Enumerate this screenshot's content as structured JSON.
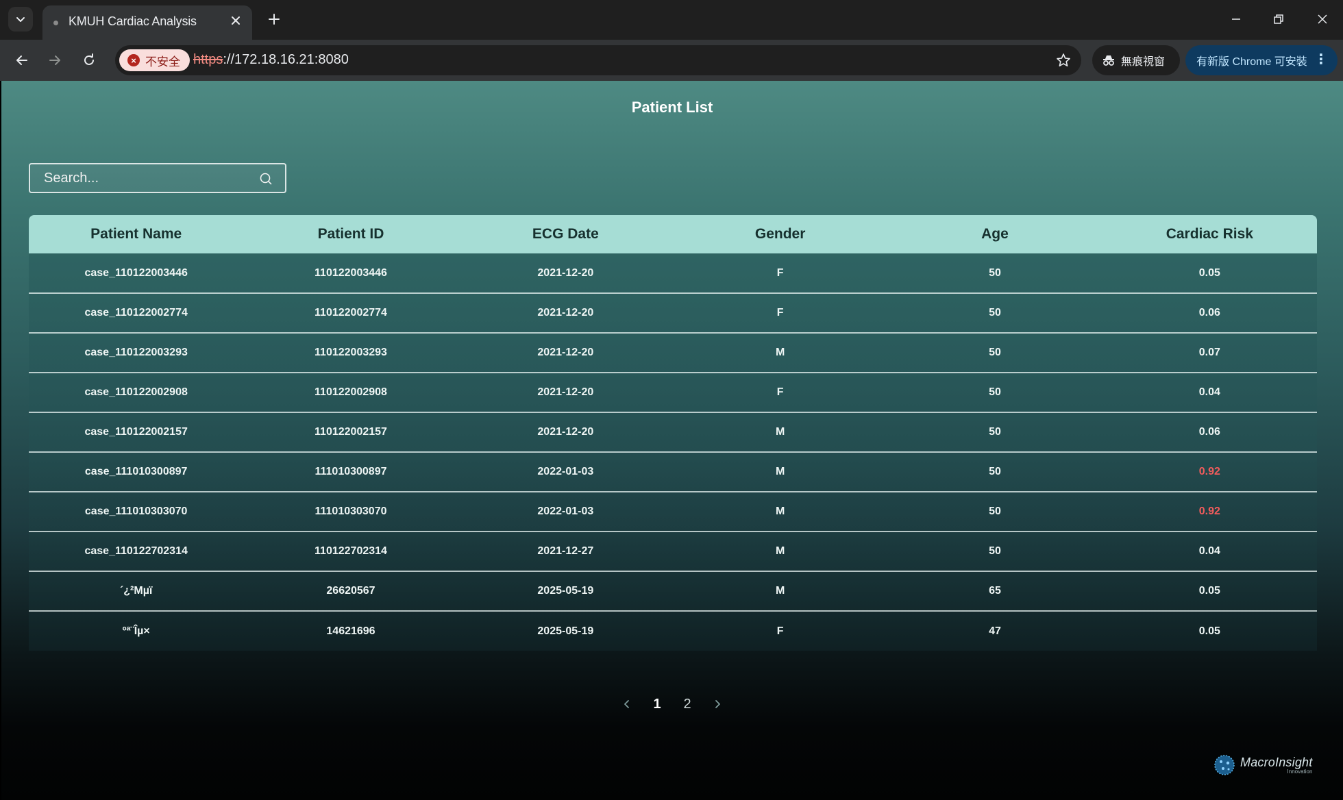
{
  "browser": {
    "tab_title": "KMUH Cardiac Analysis",
    "security_label": "不安全",
    "url_scheme": "https",
    "url_rest": "://172.18.16.21:8080",
    "incognito_label": "無痕視窗",
    "update_label": "有新版 Chrome 可安裝"
  },
  "page": {
    "title": "Patient List",
    "search": {
      "placeholder": "Search..."
    }
  },
  "table": {
    "headers": [
      "Patient Name",
      "Patient ID",
      "ECG Date",
      "Gender",
      "Age",
      "Cardiac Risk"
    ],
    "rows": [
      {
        "name": "case_110122003446",
        "id": "110122003446",
        "date": "2021-12-20",
        "gender": "F",
        "age": "50",
        "risk": "0.05"
      },
      {
        "name": "case_110122002774",
        "id": "110122002774",
        "date": "2021-12-20",
        "gender": "F",
        "age": "50",
        "risk": "0.06"
      },
      {
        "name": "case_110122003293",
        "id": "110122003293",
        "date": "2021-12-20",
        "gender": "M",
        "age": "50",
        "risk": "0.07"
      },
      {
        "name": "case_110122002908",
        "id": "110122002908",
        "date": "2021-12-20",
        "gender": "F",
        "age": "50",
        "risk": "0.04"
      },
      {
        "name": "case_110122002157",
        "id": "110122002157",
        "date": "2021-12-20",
        "gender": "M",
        "age": "50",
        "risk": "0.06"
      },
      {
        "name": "case_111010300897",
        "id": "111010300897",
        "date": "2022-01-03",
        "gender": "M",
        "age": "50",
        "risk": "0.92"
      },
      {
        "name": "case_111010303070",
        "id": "111010303070",
        "date": "2022-01-03",
        "gender": "M",
        "age": "50",
        "risk": "0.92"
      },
      {
        "name": "case_110122702314",
        "id": "110122702314",
        "date": "2021-12-27",
        "gender": "M",
        "age": "50",
        "risk": "0.04"
      },
      {
        "name": "´¿²Mµï",
        "id": "26620567",
        "date": "2025-05-19",
        "gender": "M",
        "age": "65",
        "risk": "0.05"
      },
      {
        "name": "ºª¨Îµ×",
        "id": "14621696",
        "date": "2025-05-19",
        "gender": "F",
        "age": "47",
        "risk": "0.05"
      }
    ]
  },
  "pagination": {
    "pages": [
      "1",
      "2"
    ],
    "current": "1"
  },
  "logo": {
    "name": "MacroInsight",
    "tagline": "Innovation"
  },
  "colors": {
    "header_bg": "#a6ddd5",
    "high_risk": "#f25c5c",
    "insecure_badge": "#f9dedc"
  },
  "icons": {
    "tab_search": "chevron-down-icon",
    "search": "search-icon",
    "back": "back-arrow-icon",
    "forward": "forward-arrow-icon",
    "reload": "reload-icon",
    "bookmark": "star-icon"
  }
}
